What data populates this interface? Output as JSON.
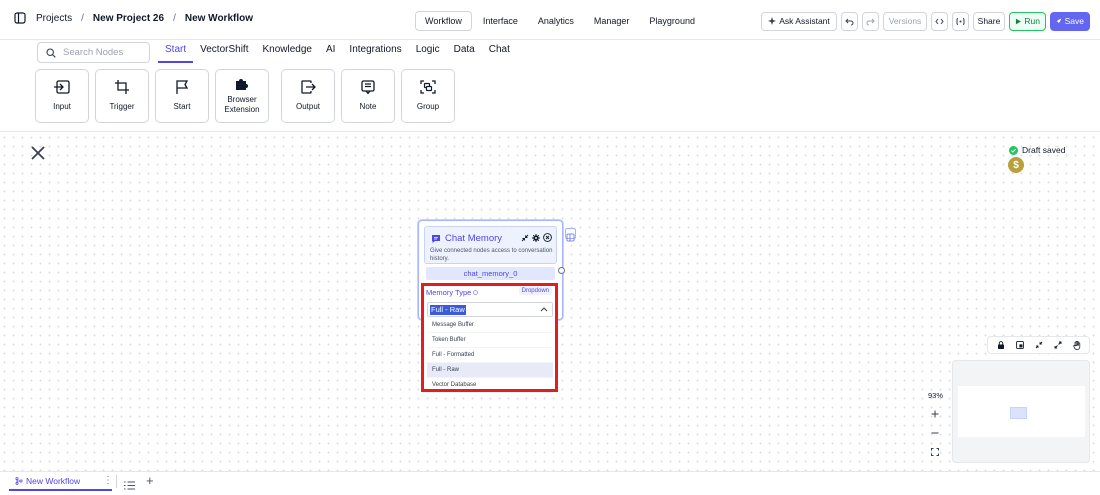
{
  "breadcrumb": {
    "root": "Projects",
    "project": "New Project 26",
    "workflow": "New Workflow"
  },
  "center_tabs": [
    {
      "label": "Workflow",
      "active": true
    },
    {
      "label": "Interface",
      "active": false
    },
    {
      "label": "Analytics",
      "active": false
    },
    {
      "label": "Manager",
      "active": false
    },
    {
      "label": "Playground",
      "active": false
    }
  ],
  "actions": {
    "ask_assistant": "Ask Assistant",
    "versions": "Versions",
    "share": "Share",
    "run": "Run",
    "save": "Save"
  },
  "search": {
    "placeholder": "Search Nodes"
  },
  "categories": [
    {
      "label": "Start",
      "active": true
    },
    {
      "label": "VectorShift",
      "active": false
    },
    {
      "label": "Knowledge",
      "active": false
    },
    {
      "label": "AI",
      "active": false
    },
    {
      "label": "Integrations",
      "active": false
    },
    {
      "label": "Logic",
      "active": false
    },
    {
      "label": "Data",
      "active": false
    },
    {
      "label": "Chat",
      "active": false
    }
  ],
  "node_tiles": {
    "input": {
      "label": "Input",
      "icon": "input-icon"
    },
    "trigger": {
      "label": "Trigger",
      "icon": "crop-icon"
    },
    "start": {
      "label": "Start",
      "icon": "flag-icon"
    },
    "browser": {
      "label": "Browser Extension",
      "icon": "puzzle-icon"
    },
    "output": {
      "label": "Output",
      "icon": "output-icon"
    },
    "note": {
      "label": "Note",
      "icon": "note-icon"
    },
    "group": {
      "label": "Group",
      "icon": "group-icon"
    }
  },
  "status": {
    "draft": "Draft saved",
    "coin_symbol": "$"
  },
  "node": {
    "title": "Chat Memory",
    "description": "Give connected nodes access to conversation history.",
    "id": "chat_memory_0",
    "field_label": "Memory Type",
    "field_badge": "Dropdown",
    "selected": "Full - Raw",
    "options": [
      "Message Buffer",
      "Token Buffer",
      "Full - Formatted",
      "Full - Raw",
      "Vector Database"
    ]
  },
  "zoom": {
    "level": "93%"
  },
  "bottom": {
    "tab_label": "New Workflow"
  },
  "colors": {
    "accent": "#4f46e5",
    "highlight": "#e11d1d",
    "run": "#22c55e"
  }
}
